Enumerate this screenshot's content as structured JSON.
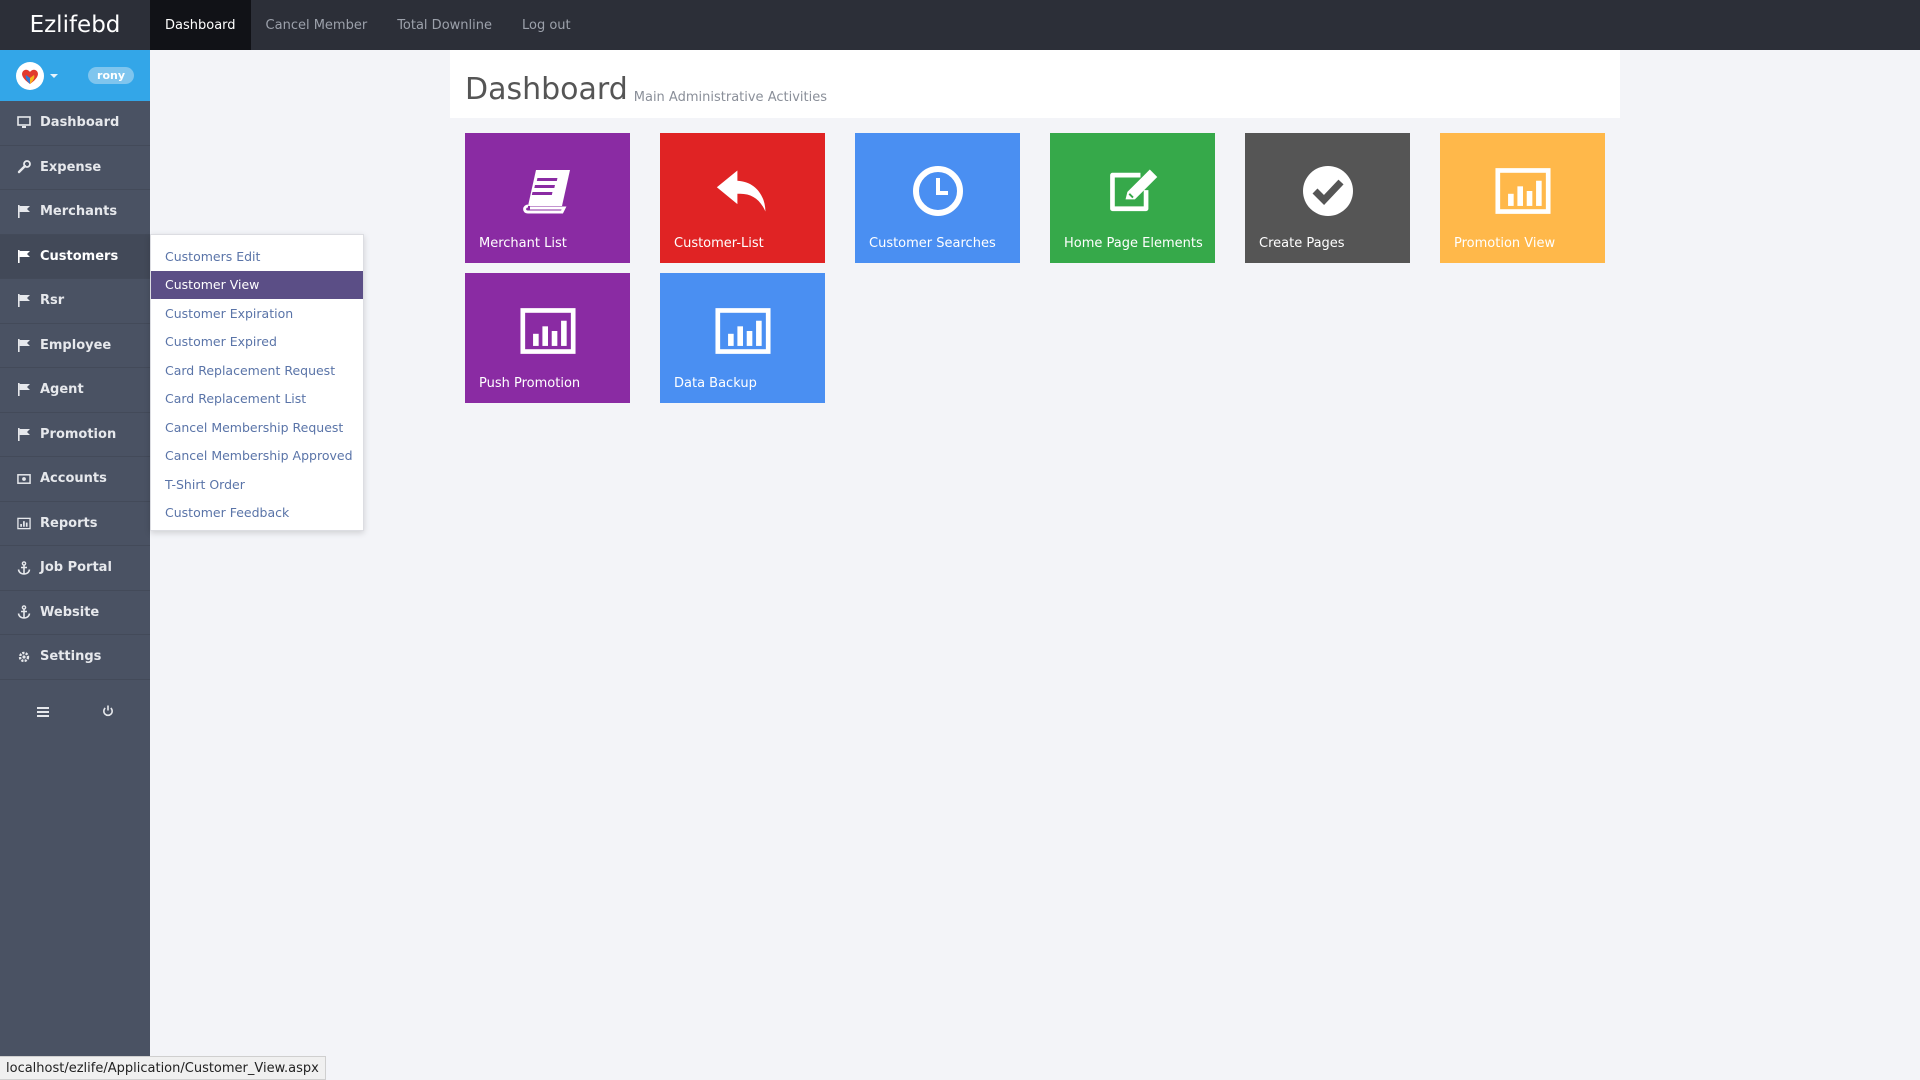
{
  "brand": "Ezlifebd",
  "top_nav": [
    {
      "label": "Dashboard",
      "active": true
    },
    {
      "label": "Cancel Member",
      "active": false
    },
    {
      "label": "Total Downline",
      "active": false
    },
    {
      "label": "Log out",
      "active": false
    }
  ],
  "user": {
    "name": "rony"
  },
  "sidebar": {
    "items": [
      {
        "label": "Dashboard",
        "icon": "monitor-icon"
      },
      {
        "label": "Expense",
        "icon": "wrench-icon"
      },
      {
        "label": "Merchants",
        "icon": "flag-icon"
      },
      {
        "label": "Customers",
        "icon": "flag-icon"
      },
      {
        "label": "Rsr",
        "icon": "flag-icon"
      },
      {
        "label": "Employee",
        "icon": "flag-icon"
      },
      {
        "label": "Agent",
        "icon": "flag-icon"
      },
      {
        "label": "Promotion",
        "icon": "flag-icon"
      },
      {
        "label": "Accounts",
        "icon": "money-icon"
      },
      {
        "label": "Reports",
        "icon": "chart-icon"
      },
      {
        "label": "Job Portal",
        "icon": "anchor-icon"
      },
      {
        "label": "Website",
        "icon": "anchor-icon"
      },
      {
        "label": "Settings",
        "icon": "gear-icon"
      }
    ]
  },
  "submenu": {
    "items": [
      "Customers Edit",
      "Customer View",
      "Customer Expiration",
      "Customer Expired",
      "Card Replacement Request",
      "Card Replacement List",
      "Cancel Membership Request",
      "Cancel Membership Approved",
      "T-Shirt Order",
      "Customer Feedback"
    ]
  },
  "header": {
    "title": "Dashboard",
    "subtitle": "Main Administrative Activities"
  },
  "tiles": [
    {
      "label": "Merchant List",
      "color": "#8a2ba3",
      "icon": "book-icon"
    },
    {
      "label": "Customer-List",
      "color": "#e02324",
      "icon": "reply-arrow-icon"
    },
    {
      "label": "Customer Searches",
      "color": "#4a8ff2",
      "icon": "clock-icon"
    },
    {
      "label": "Home Page Elements",
      "color": "#36a94a",
      "icon": "edit-icon"
    },
    {
      "label": "Create Pages",
      "color": "#555555",
      "icon": "check-circle-icon"
    },
    {
      "label": "Promotion View",
      "color": "#ffb84a",
      "icon": "bar-chart-icon"
    },
    {
      "label": "Push Promotion",
      "color": "#8a2ba3",
      "icon": "bar-chart-icon"
    },
    {
      "label": "Data Backup",
      "color": "#4a8ff2",
      "icon": "bar-chart-icon"
    }
  ],
  "statusbar": {
    "url": "localhost/ezlife/Application/Customer_View.aspx"
  }
}
